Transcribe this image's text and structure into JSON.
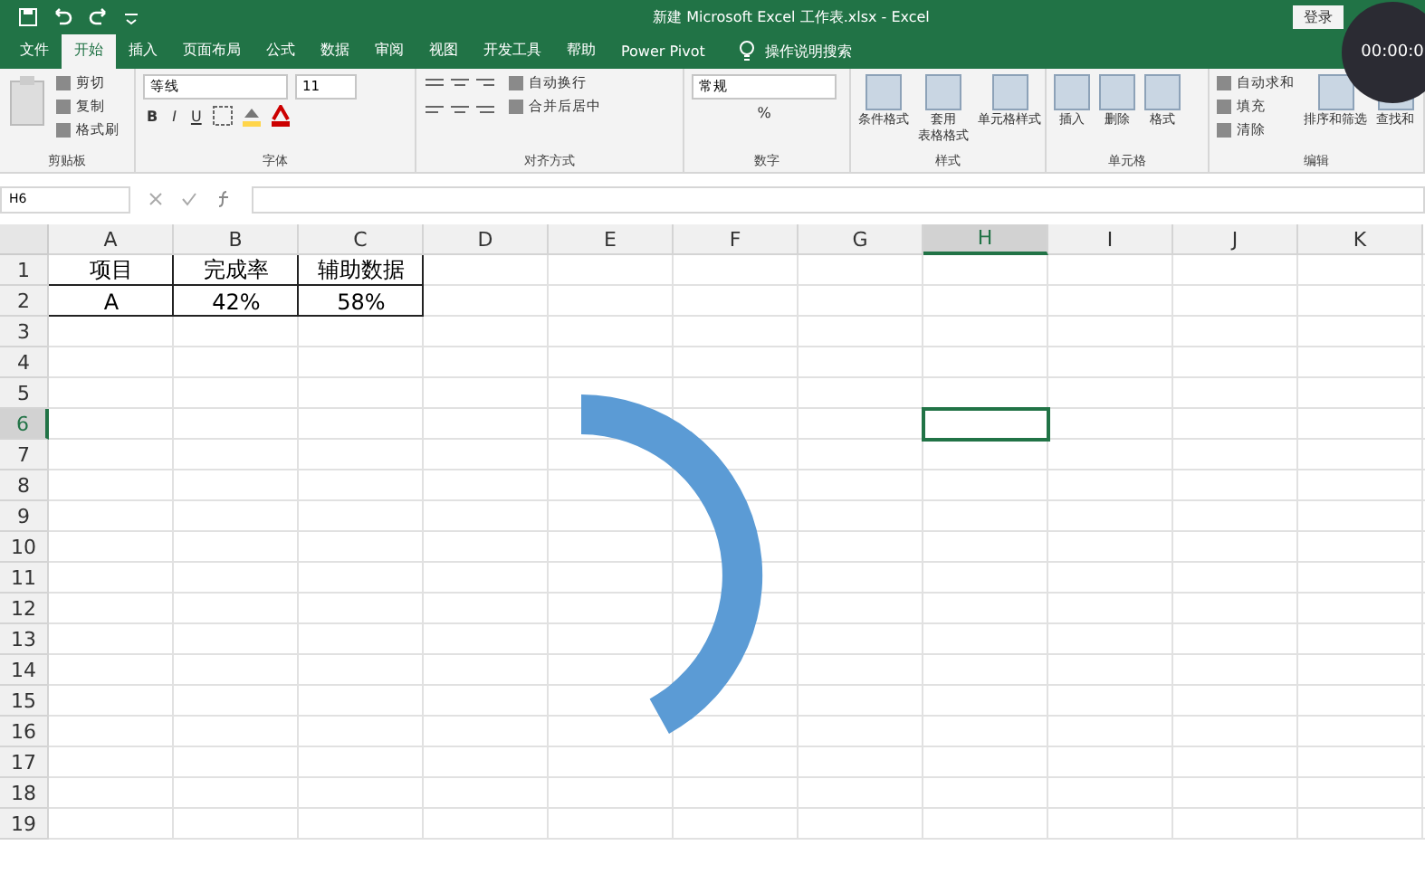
{
  "window": {
    "title": "新建 Microsoft Excel 工作表.xlsx  -  Excel",
    "login": "登录",
    "timer": "00:00:0"
  },
  "tabs": [
    {
      "label": "文件",
      "selected": false
    },
    {
      "label": "开始",
      "selected": true
    },
    {
      "label": "插入",
      "selected": false
    },
    {
      "label": "页面布局",
      "selected": false
    },
    {
      "label": "公式",
      "selected": false
    },
    {
      "label": "数据",
      "selected": false
    },
    {
      "label": "审阅",
      "selected": false
    },
    {
      "label": "视图",
      "selected": false
    },
    {
      "label": "开发工具",
      "selected": false
    },
    {
      "label": "帮助",
      "selected": false
    },
    {
      "label": "Power Pivot",
      "selected": false
    }
  ],
  "tell_me": {
    "placeholder": "操作说明搜索"
  },
  "ribbon": [
    {
      "label": "剪贴板",
      "kind": "clipboard",
      "small": [
        "剪切",
        "复制",
        "格式刷"
      ]
    },
    {
      "label": "字体",
      "kind": "font",
      "fields": [
        "等线",
        "11"
      ],
      "small": [
        "B",
        "I",
        "U"
      ]
    },
    {
      "label": "对齐方式",
      "kind": "align",
      "small": [
        "自动换行",
        "合并后居中"
      ]
    },
    {
      "label": "数字",
      "kind": "number",
      "fields": [
        "常规"
      ],
      "small": [
        "%"
      ]
    },
    {
      "label": "样式",
      "kind": "big",
      "big": [
        [
          "条件格式"
        ],
        [
          "套用",
          "表格格式"
        ],
        [
          "单元格样式"
        ]
      ]
    },
    {
      "label": "单元格",
      "kind": "big",
      "big": [
        [
          "插入"
        ],
        [
          "删除"
        ],
        [
          "格式"
        ]
      ]
    },
    {
      "label": "编辑",
      "kind": "edit",
      "small": [
        "自动求和",
        "填充",
        "清除"
      ],
      "big": [
        [
          "排序和筛选"
        ],
        [
          "查找和"
        ]
      ]
    }
  ],
  "formula_bar": {
    "name_box": "H6"
  },
  "sheet": {
    "columns": [
      {
        "label": "A",
        "selected": false
      },
      {
        "label": "B",
        "selected": false
      },
      {
        "label": "C",
        "selected": false
      },
      {
        "label": "D",
        "selected": false
      },
      {
        "label": "E",
        "selected": false
      },
      {
        "label": "F",
        "selected": false
      },
      {
        "label": "G",
        "selected": false
      },
      {
        "label": "H",
        "selected": true
      },
      {
        "label": "I",
        "selected": false
      },
      {
        "label": "J",
        "selected": false
      },
      {
        "label": "K",
        "selected": false
      }
    ],
    "rows": [
      {
        "label": "1",
        "selected": false
      },
      {
        "label": "2",
        "selected": false
      },
      {
        "label": "3",
        "selected": false
      },
      {
        "label": "4",
        "selected": false
      },
      {
        "label": "5",
        "selected": false
      },
      {
        "label": "6",
        "selected": true
      },
      {
        "label": "7",
        "selected": false
      },
      {
        "label": "8",
        "selected": false
      },
      {
        "label": "9",
        "selected": false
      },
      {
        "label": "10",
        "selected": false
      },
      {
        "label": "11",
        "selected": false
      },
      {
        "label": "12",
        "selected": false
      },
      {
        "label": "13",
        "selected": false
      },
      {
        "label": "14",
        "selected": false
      },
      {
        "label": "15",
        "selected": false
      },
      {
        "label": "16",
        "selected": false
      },
      {
        "label": "17",
        "selected": false
      },
      {
        "label": "18",
        "selected": false
      },
      {
        "label": "19",
        "selected": false
      }
    ],
    "cells": [
      [
        "项目",
        "完成率",
        "辅助数据"
      ],
      [
        "A",
        "42%",
        "58%"
      ]
    ]
  }
}
